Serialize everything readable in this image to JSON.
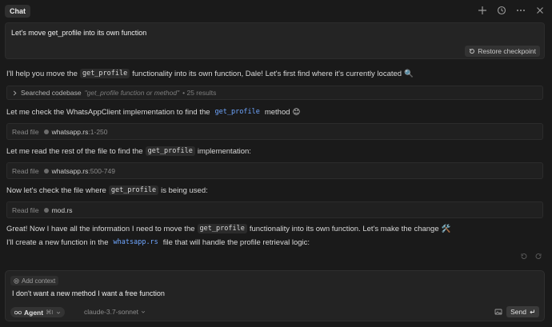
{
  "header": {
    "tab_label": "Chat",
    "icons": [
      "plus-icon",
      "history-icon",
      "more-icon",
      "close-icon"
    ]
  },
  "user_message": {
    "text": "Let's move get_profile into its own function",
    "restore_label": "Restore checkpoint"
  },
  "messages": {
    "m1": {
      "pre": "I'll help you move the",
      "code": "get_profile",
      "post": "functionality into its own function, Dale! Let's first find where it's currently located",
      "emoji": "🔍"
    },
    "search": {
      "label": "Searched codebase",
      "query": "\"get_profile function or method\"",
      "count": "• 25 results"
    },
    "m2": {
      "pre": "Let me check the WhatsAppClient implementation to find the",
      "code": "get_profile",
      "post": "method",
      "emoji": "😊"
    },
    "read1": {
      "label": "Read file",
      "file": "whatsapp.rs",
      "range": ":1-250"
    },
    "m3": {
      "pre": "Let me read the rest of the file to find the",
      "code": "get_profile",
      "post": "implementation:"
    },
    "read2": {
      "label": "Read file",
      "file": "whatsapp.rs",
      "range": ":500-749"
    },
    "m4": {
      "pre": "Now let's check the file where",
      "code": "get_profile",
      "post": "is being used:"
    },
    "read3": {
      "label": "Read file",
      "file": "mod.rs"
    },
    "m5": {
      "pre": "Great! Now I have all the information I need to move the",
      "code": "get_profile",
      "post": "functionality into its own function. Let's make the change",
      "emoji": "🛠️"
    },
    "m6": {
      "pre": "I'll create a new function in the",
      "code": "whatsapp.rs",
      "post": "file that will handle the profile retrieval logic:"
    }
  },
  "composer": {
    "add_context": "Add context",
    "input_value": "I don't want a new method I want a free function",
    "agent_label": "Agent",
    "agent_shortcut": "⌘I",
    "model": "claude-3.7-sonnet",
    "send_label": "Send"
  },
  "colors": {
    "background": "#1a1a1a",
    "accent_code": "#6fa6ff"
  }
}
